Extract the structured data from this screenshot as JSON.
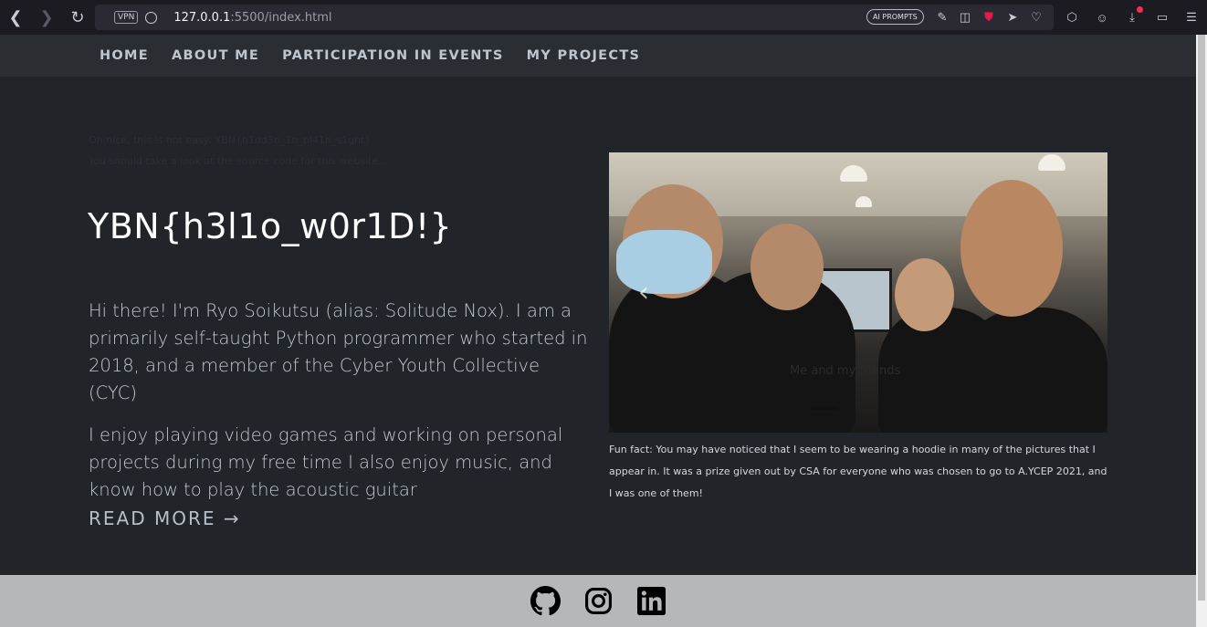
{
  "browser": {
    "vpn_label": "VPN",
    "url_host": "127.0.0.1",
    "url_rest": ":5500/index.html",
    "ai_prompts_label": "AI PROMPTS",
    "icons": [
      "back-icon",
      "forward-icon",
      "reload-icon",
      "globe-icon",
      "share-icon",
      "camera-icon",
      "shield-icon",
      "send-icon",
      "heart-icon",
      "cube-icon",
      "account-icon",
      "download-icon",
      "battery-icon",
      "menu-icon"
    ],
    "accent_color": "#e6194b"
  },
  "nav": {
    "items": [
      {
        "label": "HOME"
      },
      {
        "label": "ABOUT ME"
      },
      {
        "label": "PARTICIPATION IN EVENTS"
      },
      {
        "label": "MY PROJECTS"
      }
    ]
  },
  "hidden_message": {
    "line1": "Oh nice, this is not easy: YBN{h1dd3n_1n_pl41n_s1ght}",
    "line2": "You should take a look at the source code for this website..."
  },
  "hero": {
    "title": "YBN{h3l1o_w0r1D!}",
    "paragraph1": "Hi there! I'm Ryo Soikutsu (alias: Solitude Nox). I am a primarily self-taught Python programmer who started in 2018, and a member of the Cyber Youth Collective (CYC)",
    "paragraph2": "I enjoy playing video games and working on personal projects during my free time I also enjoy music, and know how to play the acoustic guitar",
    "read_more": "READ MORE →"
  },
  "carousel": {
    "prev_glyph": "‹",
    "overlay_caption": "Me and my friends"
  },
  "fun_fact": "Fun fact: You may have noticed that I seem to be wearing a hoodie in many of the pictures that I appear in. It was a prize given out by CSA for everyone who was chosen to go to A.YCEP 2021, and I was one of them!",
  "footer": {
    "icons": [
      "github-icon",
      "instagram-icon",
      "linkedin-icon"
    ]
  }
}
